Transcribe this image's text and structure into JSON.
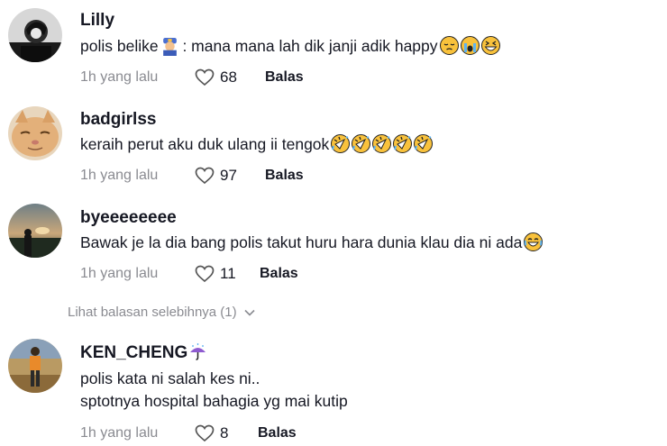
{
  "comments": [
    {
      "username": "Lilly",
      "text_before": "polis belike",
      "text_after": " : mana mana lah dik janji adik happy",
      "time": "1h yang lalu",
      "likes": "68",
      "reply_label": "Balas"
    },
    {
      "username": "badgirlss",
      "text": "keraih perut aku duk ulang ii tengok",
      "time": "1h yang lalu",
      "likes": "97",
      "reply_label": "Balas"
    },
    {
      "username": "byeeeeeeee",
      "text": "Bawak je la dia bang polis takut huru hara dunia klau dia ni ada",
      "time": "1h yang lalu",
      "likes": "11",
      "reply_label": "Balas"
    },
    {
      "username": "KEN_CHENG",
      "text_line1": "polis kata ni salah kes ni..",
      "text_line2": "sptotnya hospital bahagia yg mai kutip",
      "time": "1h yang lalu",
      "likes": "8",
      "reply_label": "Balas"
    }
  ],
  "view_more_replies": "Lihat balasan selebihnya (1)",
  "colors": {
    "text": "#161823",
    "muted": "#8a8b91",
    "emoji_yellow": "#f9c23c"
  }
}
